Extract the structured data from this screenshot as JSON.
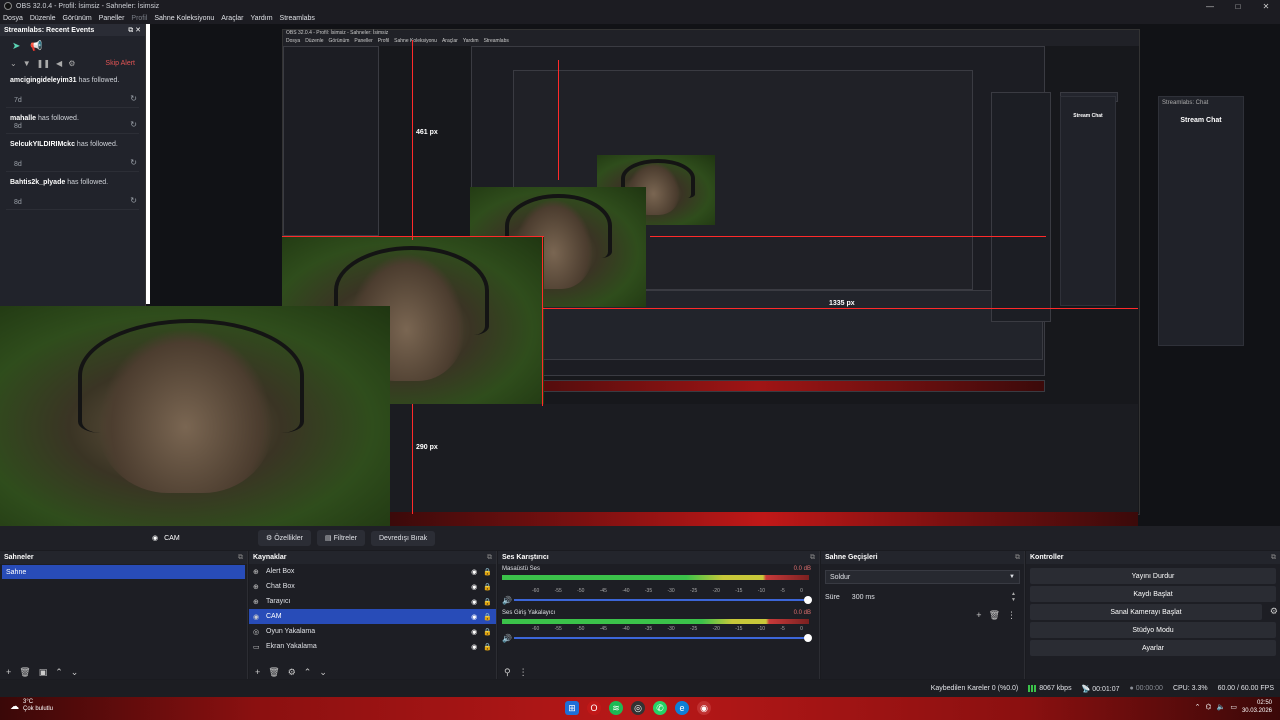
{
  "window": {
    "title": "OBS 32.0.4 - Profil: İsimsiz - Sahneler: İsimsiz",
    "controls": [
      "—",
      "□",
      "✕"
    ]
  },
  "menu": {
    "items": [
      "Dosya",
      "Düzenle",
      "Görünüm",
      "Paneller",
      "Profil",
      "Sahne Koleksiyonu",
      "Araçlar",
      "Yardım",
      "Streamlabs"
    ]
  },
  "recent_events": {
    "title": "Streamlabs: Recent Events",
    "skip_label": "Skip Alert",
    "items": [
      {
        "name": "amcigingideleyim31",
        "action": "has followed.",
        "age": "7d"
      },
      {
        "name": "mahalle",
        "action": "has followed.",
        "age": "8d"
      },
      {
        "name": "SelcukYILDIRIMckc",
        "action": "has followed.",
        "age": "8d"
      },
      {
        "name": "Bahtis2k_plyade",
        "action": "has followed.",
        "age": "8d"
      }
    ]
  },
  "preview_labels": {
    "px_461": "461 px",
    "px_290": "290 px",
    "px_1335": "1335 px"
  },
  "nested_chat": {
    "title": "Streamlabs: Chat",
    "label": "Stream Chat"
  },
  "source_bar": {
    "current": "CAM",
    "properties": "Özellikler",
    "filters": "Filtreler",
    "deactivate": "Devredışı Bırak"
  },
  "scenes": {
    "title": "Sahneler",
    "items": [
      "Sahne"
    ]
  },
  "sources": {
    "title": "Kaynaklar",
    "items": [
      {
        "label": "Alert Box",
        "icon": "⊕",
        "selected": false
      },
      {
        "label": "Chat Box",
        "icon": "⊕",
        "selected": false
      },
      {
        "label": "Tarayıcı",
        "icon": "⊕",
        "selected": false
      },
      {
        "label": "CAM",
        "icon": "◉",
        "selected": true
      },
      {
        "label": "Oyun Yakalama",
        "icon": "◎",
        "selected": false
      },
      {
        "label": "Ekran Yakalama",
        "icon": "▭",
        "selected": false
      }
    ]
  },
  "mixer": {
    "title": "Ses Karıştırıcı",
    "channels": [
      {
        "name": "Masaüstü Ses",
        "db": "0.0 dB"
      },
      {
        "name": "Ses Giriş Yakalayıcı",
        "db": "0.0 dB"
      }
    ],
    "ticks": [
      "-60",
      "-55",
      "-50",
      "-45",
      "-40",
      "-35",
      "-30",
      "-25",
      "-20",
      "-15",
      "-10",
      "-5",
      "0"
    ]
  },
  "transitions": {
    "title": "Sahne Geçişleri",
    "selected": "Soldur",
    "duration_label": "Süre",
    "duration_value": "300 ms"
  },
  "controls": {
    "title": "Kontroller",
    "buttons": [
      "Yayını Durdur",
      "Kaydı Başlat",
      "Sanal Kamerayı Başlat",
      "Stüdyo Modu",
      "Ayarlar"
    ]
  },
  "status": {
    "dropped": "Kaybedilen Kareler 0 (%0.0)",
    "bitrate": "8067 kbps",
    "stream_time": "00:01:07",
    "rec_time": "00:00:00",
    "cpu": "CPU: 3.3%",
    "fps": "60.00 / 60.00 FPS"
  },
  "taskbar": {
    "temp": "3°C",
    "weather": "Çok bulutlu",
    "time": "02:50",
    "date": "30.03.2026",
    "icons": [
      "windows-icon",
      "opera-icon",
      "spotify-icon",
      "obs-icon",
      "whatsapp-icon",
      "edge-icon",
      "chrome-icon"
    ]
  },
  "colors": {
    "accent": "#284cb8",
    "guide": "#ff2a2a",
    "events": "#5bd3b4",
    "skip": "#e25454"
  }
}
